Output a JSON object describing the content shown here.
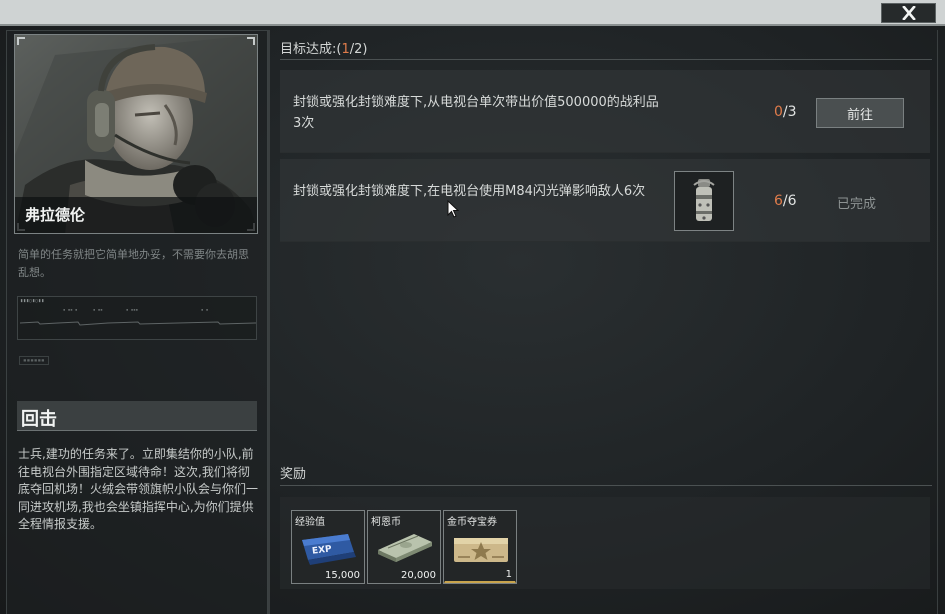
{
  "window": {
    "close_icon": "close-x-icon"
  },
  "character": {
    "name": "弗拉德伦",
    "description": "简单的任务就把它简单地办妥，不需要你去胡思乱想。"
  },
  "mission": {
    "title": "回击",
    "briefing": "士兵,建功的任务来了。立即集结你的小队,前往电视台外围指定区域待命！这次,我们将彻底夺回机场！火绒会带领旗帜小队会与你们一同进攻机场,我也会坐镇指挥中心,为你们提供全程情报支援。"
  },
  "objectives": {
    "header_label": "目标达成:(",
    "header_done": "1",
    "header_total": "/2)",
    "items": [
      {
        "text": "封锁或强化封锁难度下,从电视台单次带出价值500000的战利品3次",
        "progress_current": "0",
        "progress_total": "/3",
        "action_label": "前往"
      },
      {
        "text": "封锁或强化封锁难度下,在电视台使用M84闪光弹影响敌人6次",
        "progress_current": "6",
        "progress_total": "/6",
        "status_label": "已完成",
        "item_icon": "flashbang-grenade-icon"
      }
    ]
  },
  "rewards": {
    "title": "奖励",
    "items": [
      {
        "name": "经验值",
        "quantity": "15,000",
        "icon": "exp-ticket-icon"
      },
      {
        "name": "柯恩币",
        "quantity": "20,000",
        "icon": "cash-stack-icon"
      },
      {
        "name": "金币夺宝券",
        "quantity": "1",
        "icon": "gold-coupon-icon",
        "rarity_color": "#c9a44d"
      }
    ]
  },
  "colors": {
    "accent": "#e07c4b",
    "panel": "#2a2f31",
    "gold": "#c9a44d"
  }
}
